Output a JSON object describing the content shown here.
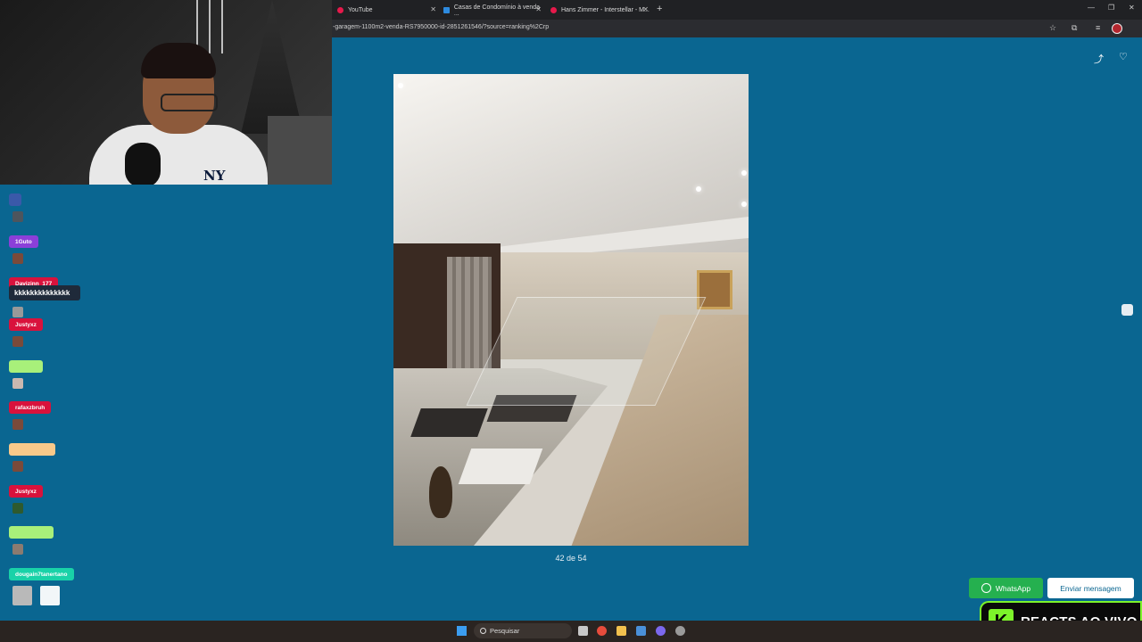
{
  "browser": {
    "tabs": [
      {
        "label": "YouTube"
      },
      {
        "label": "Casas de Condomínio à venda ..."
      },
      {
        "label": "Hans Zimmer - Interstellar - M..."
      }
    ],
    "url": "-garagem-1100m2-venda-RS7950000-id-2851261546/?source=ranking%2Crp"
  },
  "webcam": {
    "shirt_logo": "NY"
  },
  "gallery": {
    "counter": "42 de 54",
    "share_icon": "share-icon",
    "favorite_icon": "heart-icon"
  },
  "chat": {
    "users": [
      {
        "name": "1Guto",
        "color": "#8b3fd9"
      },
      {
        "name": "Davizinn_177",
        "color": "#d9123c"
      },
      {
        "name": "Justyxz",
        "color": "#d9123c"
      },
      {
        "name": "",
        "color": "#a8f07a"
      },
      {
        "name": "rafaxzbruh",
        "color": "#d9123c"
      },
      {
        "name": "",
        "color": "#f8c98a"
      },
      {
        "name": "Justyxz",
        "color": "#d9123c"
      },
      {
        "name": "",
        "color": "#a8f07a"
      },
      {
        "name": "dougain7tanertano",
        "color": "#19d2a8"
      }
    ],
    "message": "kkkkkkkkkkkkkk"
  },
  "actions": {
    "whatsapp": "WhatsApp",
    "send_message": "Enviar mensagem"
  },
  "overlay": {
    "brand_letter": "K",
    "brand_text": "REACTS AO VIVO"
  },
  "taskbar": {
    "search_placeholder": "Pesquisar"
  }
}
